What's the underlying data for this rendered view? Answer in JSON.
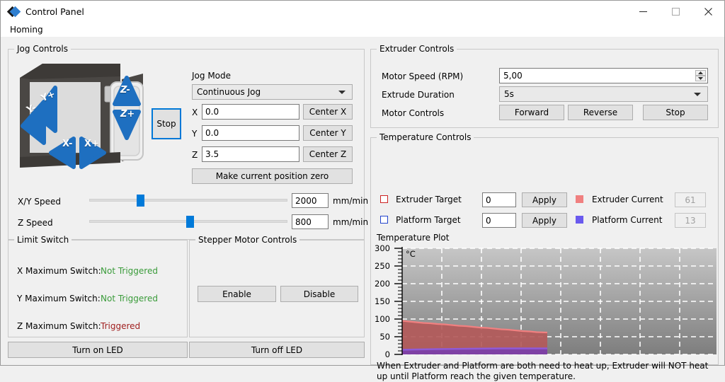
{
  "window": {
    "title": "Control Panel",
    "icon": "app-diamond-icon",
    "minimize": "minimize-icon",
    "maximize": "maximize-icon",
    "close": "close-icon"
  },
  "menu": {
    "items": [
      {
        "label": "Homing"
      }
    ]
  },
  "jog_controls": {
    "legend": "Jog Controls",
    "printer_buttons": [
      {
        "label": "Y-",
        "name": "jog-y-minus"
      },
      {
        "label": "Y+",
        "name": "jog-y-plus"
      },
      {
        "label": "X-",
        "name": "jog-x-minus"
      },
      {
        "label": "X+",
        "name": "jog-x-plus"
      },
      {
        "label": "Z-",
        "name": "jog-z-minus"
      },
      {
        "label": "Z+",
        "name": "jog-z-plus"
      }
    ],
    "stop_label": "Stop",
    "jog_mode_label": "Jog Mode",
    "jog_mode_value": "Continuous Jog",
    "axes": [
      {
        "label": "X",
        "value": "0.0",
        "button": "Center X"
      },
      {
        "label": "Y",
        "value": "0.0",
        "button": "Center Y"
      },
      {
        "label": "Z",
        "value": "3.5",
        "button": "Center Z"
      }
    ],
    "make_zero_label": "Make current position zero",
    "speeds": [
      {
        "label": "X/Y Speed",
        "value": "2000",
        "unit": "mm/min",
        "percent": 19
      },
      {
        "label": "Z Speed",
        "value": "800",
        "unit": "mm/min",
        "percent": 51
      }
    ]
  },
  "limit_switch": {
    "legend": "Limit Switch",
    "rows": [
      {
        "label": "X Maximum Switch:",
        "status": "Not Triggered",
        "color": "#3a9b3a"
      },
      {
        "label": "Y Maximum Switch:",
        "status": "Not Triggered",
        "color": "#3a9b3a"
      },
      {
        "label": "Z Maximum Switch:",
        "status": "Triggered",
        "color": "#a02020"
      }
    ]
  },
  "stepper_motor": {
    "legend": "Stepper Motor Controls",
    "enable_label": "Enable",
    "disable_label": "Disable"
  },
  "led": {
    "on_label": "Turn on LED",
    "off_label": "Turn off LED"
  },
  "extruder_controls": {
    "legend": "Extruder Controls",
    "motor_speed_label": "Motor Speed (RPM)",
    "motor_speed_value": "5,00",
    "extrude_duration_label": "Extrude Duration",
    "extrude_duration_value": "5s",
    "motor_controls_label": "Motor Controls",
    "forward_label": "Forward",
    "reverse_label": "Reverse",
    "stop_label": "Stop"
  },
  "temperature_controls": {
    "legend": "Temperature Controls",
    "rows": [
      {
        "checkbox_color": "#cc2222",
        "label": "Extruder Target",
        "value": "0",
        "apply_label": "Apply",
        "swatch_color": "#f08080",
        "current_label": "Extruder Current",
        "current_value": "61"
      },
      {
        "checkbox_color": "#2244cc",
        "label": "Platform Target",
        "value": "0",
        "apply_label": "Apply",
        "swatch_color": "#6a5aee",
        "current_label": "Platform Current",
        "current_value": "13"
      }
    ],
    "plot_title": "Temperature Plot",
    "note": "When Extruder and Platform are both need to heat up, Extruder will NOT heat up until Platform reach the given temperature."
  },
  "chart_data": {
    "type": "area",
    "title": "Temperature Plot",
    "unit_label": "°C",
    "ylabel": "",
    "xlabel": "",
    "ylim": [
      0,
      300
    ],
    "yticks": [
      0,
      50,
      100,
      150,
      200,
      250,
      300
    ],
    "minor_tick_step": 10,
    "grid": true,
    "legend": "none",
    "series": [
      {
        "name": "Extruder Current",
        "color": "#f08080",
        "fill": "#b35a5a",
        "x": [
          0,
          1,
          2,
          3,
          4,
          5,
          6,
          7,
          8,
          9,
          10,
          11,
          12,
          13,
          14,
          15,
          16,
          17,
          18,
          19,
          20
        ],
        "values": [
          95,
          93,
          91,
          89,
          88,
          86,
          85,
          83,
          81,
          80,
          78,
          76,
          75,
          73,
          71,
          70,
          68,
          66,
          65,
          63,
          62
        ]
      },
      {
        "name": "Platform Current",
        "color": "#6a5aee",
        "fill": "#7b3fa8",
        "x": [
          0,
          1,
          2,
          3,
          4,
          5,
          6,
          7,
          8,
          9,
          10,
          11,
          12,
          13,
          14,
          15,
          16,
          17,
          18,
          19,
          20
        ],
        "values": [
          13,
          14,
          14,
          15,
          15,
          15,
          16,
          16,
          16,
          16,
          17,
          17,
          17,
          17,
          17,
          17,
          17,
          17,
          17,
          17,
          17
        ]
      }
    ]
  }
}
